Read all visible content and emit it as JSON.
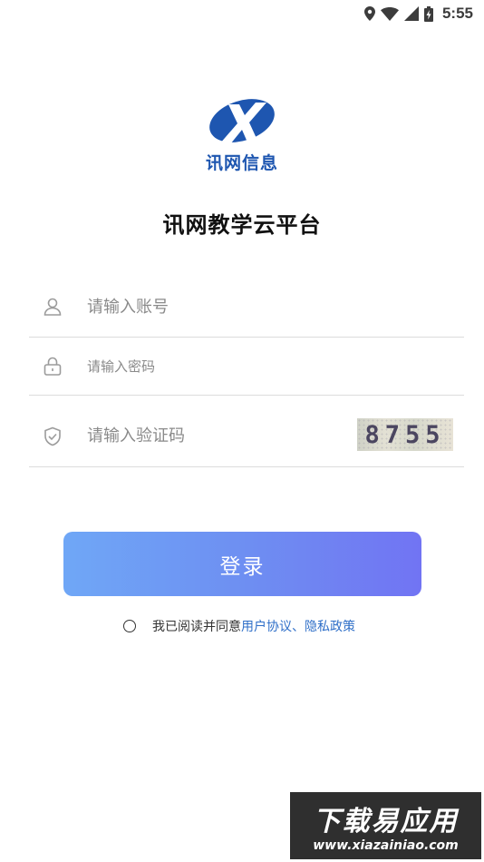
{
  "status_bar": {
    "time": "5:55",
    "icons": [
      "location-icon",
      "wifi-icon",
      "signal-icon",
      "battery-icon"
    ]
  },
  "logo": {
    "text": "讯网信息",
    "brand_color": "#1e56b0"
  },
  "app_title": "讯网教学云平台",
  "form": {
    "account": {
      "placeholder": "请输入账号",
      "value": ""
    },
    "password": {
      "placeholder": "请输入密码",
      "value": ""
    },
    "code": {
      "placeholder": "请输入验证码",
      "value": ""
    },
    "captcha_text": "8755"
  },
  "login_button": "登录",
  "agreement": {
    "prefix": "我已阅读并同意",
    "user_agreement": "用户协议",
    "separator": "、",
    "privacy_policy": "隐私政策",
    "checked": false
  },
  "watermark": {
    "title": "下载易应用",
    "url": "www.xiazainiao.com"
  },
  "colors": {
    "accent_link": "#2f6fc8",
    "button_gradient_start": "#6fa7f6",
    "button_gradient_end": "#7174f3"
  }
}
